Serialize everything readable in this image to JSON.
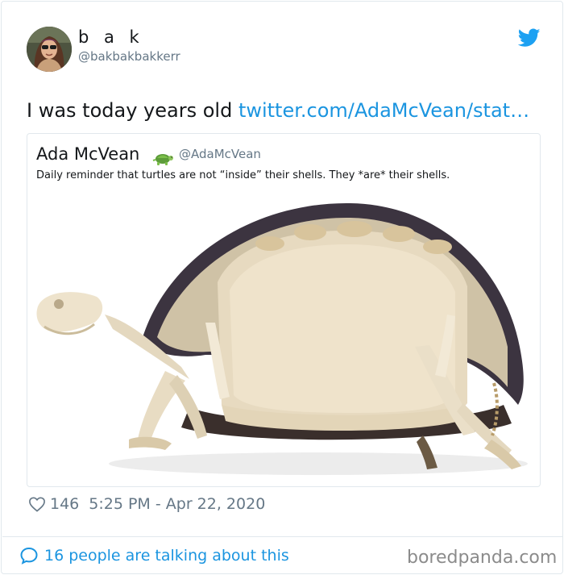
{
  "author": {
    "display_name": "b a k",
    "handle": "@bakbakbakkerr"
  },
  "tweet": {
    "text": "I was today years old ",
    "link_text": "twitter.com/AdaMcVean/stat…"
  },
  "quoted_tweet": {
    "display_name": "Ada McVean",
    "emoji_icon": "turtle-emoji",
    "handle": "@AdaMcVean",
    "text": "Daily reminder that turtles are not “inside” their shells. They *are* their shells."
  },
  "meta": {
    "likes": "146",
    "timestamp": "5:25 PM - Apr 22, 2020"
  },
  "footer": {
    "conversation_text": "16 people are talking about this"
  },
  "watermark": "boredpanda.com",
  "colors": {
    "link": "#1b95e0",
    "muted": "#657786",
    "text": "#14171a",
    "border": "#e1e8ed"
  }
}
